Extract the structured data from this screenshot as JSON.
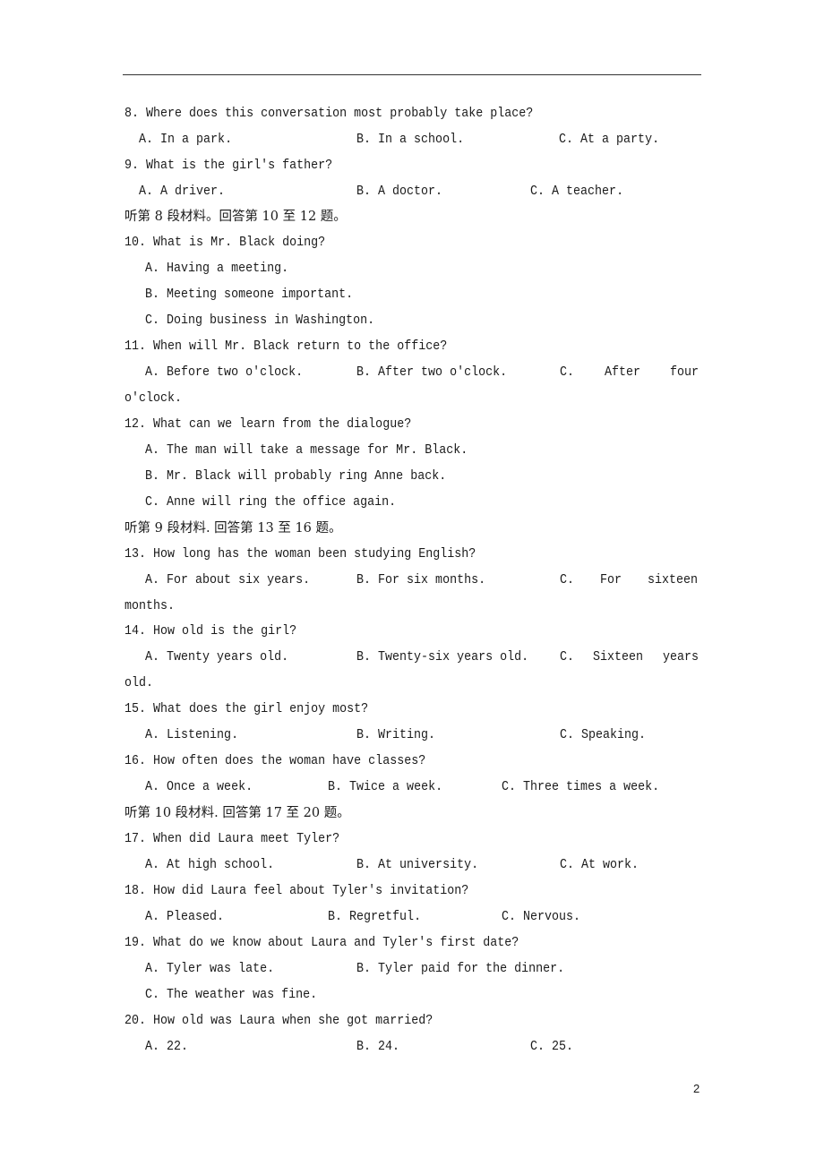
{
  "page_number": "2",
  "section_headers": {
    "s8": "听第 8 段材料。回答第 10 至 12 题。",
    "s9": "听第 9 段材料. 回答第 13 至 16 题。",
    "s10": "听第 10 段材料. 回答第 17 至 20 题。"
  },
  "questions": {
    "q8": {
      "text": "8. Where does this conversation most probably take place?",
      "a": "A. In a park.",
      "b": "B. In a school.",
      "c": "C. At a party."
    },
    "q9": {
      "text": "9. What is the girl's father?",
      "a": "A. A driver.",
      "b": "B. A doctor.",
      "c": "C. A teacher."
    },
    "q10": {
      "text": "10. What is Mr. Black doing?",
      "a": "A. Having a meeting.",
      "b": "B. Meeting someone important.",
      "c": "C. Doing business in Washington."
    },
    "q11": {
      "text": "11. When will Mr. Black return to the office?",
      "a": "A. Before two o'clock.",
      "b": "B. After two o'clock.",
      "c1": "C.",
      "c2": "After",
      "c3": "four",
      "c_cont": "o'clock."
    },
    "q12": {
      "text": "12. What can we learn from the dialogue?",
      "a": "A. The man will take a message for Mr. Black.",
      "b": "B. Mr. Black will probably ring Anne back.",
      "c": "C. Anne will ring the office again."
    },
    "q13": {
      "text": "13. How long has the woman been studying English?",
      "a": "A. For about six years.",
      "b": "B. For six months.",
      "c1": "C.",
      "c2": "For",
      "c3": "sixteen",
      "c_cont": "months."
    },
    "q14": {
      "text": "14. How old is the girl?",
      "a": "A. Twenty years old.",
      "b": "B. Twenty-six years old.",
      "c1": "C.",
      "c2": "Sixteen",
      "c3": "years",
      "c_cont": "old."
    },
    "q15": {
      "text": "15. What does the girl enjoy most?",
      "a": "A. Listening.",
      "b": "B. Writing.",
      "c": "C. Speaking."
    },
    "q16": {
      "text": "16. How often does the woman have classes?",
      "a": "A. Once a week.",
      "b": "B. Twice a week.",
      "c": "C. Three times a week."
    },
    "q17": {
      "text": "17. When did Laura meet Tyler?",
      "a": "A. At high school.",
      "b": "B. At university.",
      "c": "C. At work."
    },
    "q18": {
      "text": "18. How did Laura feel about Tyler's invitation?",
      "a": "A. Pleased.",
      "b": "B. Regretful.",
      "c": "C. Nervous."
    },
    "q19": {
      "text": "19. What do we know about Laura and Tyler's first date?",
      "a": "A. Tyler was late.",
      "b": "B. Tyler paid for the dinner.",
      "c": "C. The weather was fine."
    },
    "q20": {
      "text": "20. How old was Laura when she got married?",
      "a": "A. 22.",
      "b": "B. 24.",
      "c": "C. 25."
    }
  }
}
